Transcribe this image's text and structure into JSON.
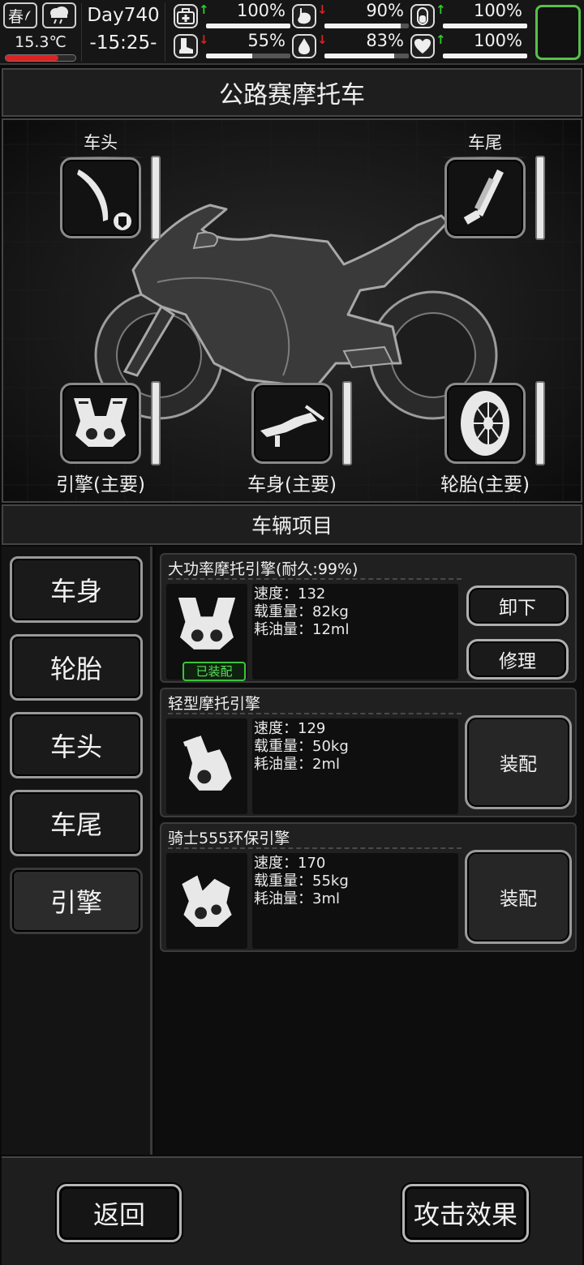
{
  "status": {
    "season": "春",
    "temperature": "15.3℃",
    "temperature_level": 0.75,
    "day": "Day740",
    "time": "-15:25-",
    "stats": [
      {
        "icon": "medkit-icon",
        "trend": "up",
        "value": "100%",
        "level": 1.0
      },
      {
        "icon": "stomach-icon",
        "trend": "down",
        "value": "90%",
        "level": 0.9
      },
      {
        "icon": "stamina-icon",
        "trend": "up",
        "value": "100%",
        "level": 1.0
      },
      {
        "icon": "boot-icon",
        "trend": "down",
        "value": "55%",
        "level": 0.55
      },
      {
        "icon": "water-drop-icon",
        "trend": "down",
        "value": "83%",
        "level": 0.83
      },
      {
        "icon": "heart-icon",
        "trend": "up",
        "value": "100%",
        "level": 1.0
      }
    ]
  },
  "title": "公路赛摩托车",
  "slots": {
    "head": "车头",
    "tail": "车尾",
    "engine": "引擎(主要)",
    "body": "车身(主要)",
    "tire": "轮胎(主要)"
  },
  "items_header": "车辆项目",
  "categories": [
    "车身",
    "轮胎",
    "车头",
    "车尾",
    "引擎"
  ],
  "active_category": "引擎",
  "items": [
    {
      "name": "大功率摩托引擎(耐久:99%)",
      "stats": [
        "速度：132",
        "载重量：82kg",
        "耗油量：12ml"
      ],
      "equipped_label": "已装配",
      "buttons": [
        "卸下",
        "修理"
      ]
    },
    {
      "name": "轻型摩托引擎",
      "stats": [
        "速度：129",
        "载重量：50kg",
        "耗油量：2ml"
      ],
      "buttons": [
        "装配"
      ]
    },
    {
      "name": "骑士555环保引擎",
      "stats": [
        "速度：170",
        "载重量：55kg",
        "耗油量：3ml"
      ],
      "buttons": [
        "装配"
      ]
    }
  ],
  "bottom": {
    "back": "返回",
    "attack": "攻击效果"
  }
}
